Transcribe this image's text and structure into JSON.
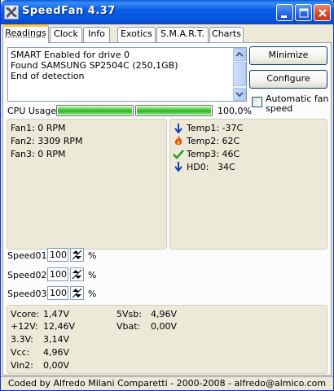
{
  "window": {
    "title": "SpeedFan 4.37"
  },
  "tabs": [
    {
      "label": "Readings",
      "active": true
    },
    {
      "label": "Clock"
    },
    {
      "label": "Info"
    },
    {
      "label": "Exotics"
    },
    {
      "label": "S.M.A.R.T."
    },
    {
      "label": "Charts"
    }
  ],
  "log": {
    "lines": [
      "SMART Enabled for drive 0",
      "Found SAMSUNG SP2504C (250,1GB)",
      "End of detection"
    ]
  },
  "buttons": {
    "minimize": "Minimize",
    "configure": "Configure"
  },
  "auto_fan": {
    "label_line1": "Automatic fan",
    "label_line2": "speed",
    "checked": false
  },
  "cpu": {
    "label": "CPU Usage",
    "percent_text": "100,0%",
    "core_fractions": [
      1.0,
      1.0
    ]
  },
  "fans": [
    {
      "label": "Fan1:",
      "value": "0 RPM"
    },
    {
      "label": "Fan2:",
      "value": "3309 RPM"
    },
    {
      "label": "Fan3:",
      "value": "0 RPM"
    }
  ],
  "temps": [
    {
      "icon": "arrow-down-icon",
      "label": "Temp1:",
      "value": "-37C"
    },
    {
      "icon": "flame-icon",
      "label": "Temp2:",
      "value": "62C"
    },
    {
      "icon": "checkmark-icon",
      "label": "Temp3:",
      "value": "46C"
    },
    {
      "icon": "arrow-down-icon",
      "label": "HD0:",
      "value": "34C"
    }
  ],
  "speeds": [
    {
      "label": "Speed01:",
      "value": "100",
      "unit": "%"
    },
    {
      "label": "Speed02:",
      "value": "100",
      "unit": "%"
    },
    {
      "label": "Speed03:",
      "value": "100",
      "unit": "%"
    }
  ],
  "voltages_left": [
    {
      "label": "Vcore:",
      "value": "1,47V"
    },
    {
      "label": "+12V:",
      "value": "12,46V"
    },
    {
      "label": "3.3V:",
      "value": "3,14V"
    },
    {
      "label": "Vcc:",
      "value": "4,96V"
    },
    {
      "label": "Vin2:",
      "value": "0,00V"
    }
  ],
  "voltages_right": [
    {
      "label": "5Vsb:",
      "value": "4,96V"
    },
    {
      "label": "Vbat:",
      "value": "0,00V"
    }
  ],
  "status": {
    "text": "Coded by Alfredo Milani Comparetti - 2000-2008 - alfredo@almico.com"
  },
  "colors": {
    "title_blue": "#0a5be0",
    "tab_highlight": "#ffc83c",
    "cpu_green": "#3cc635",
    "arrow_blue": "#1a3fb8",
    "check_green": "#2a9a2a",
    "flame_orange": "#e84a10"
  }
}
